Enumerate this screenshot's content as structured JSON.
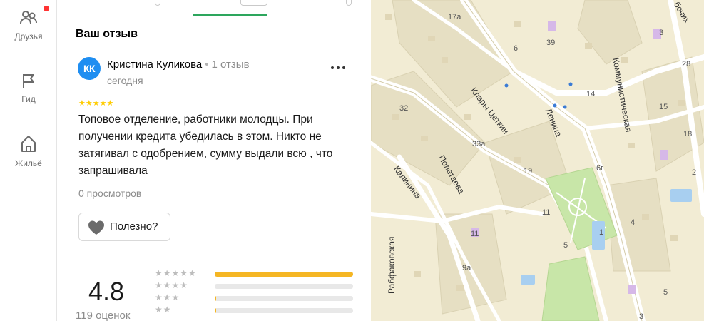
{
  "sidebar": {
    "items": [
      {
        "label": "Друзья",
        "icon": "friends-icon"
      },
      {
        "label": "Гид",
        "icon": "flag-icon"
      },
      {
        "label": "Жильё",
        "icon": "house-icon"
      }
    ]
  },
  "review_section": {
    "title": "Ваш отзыв",
    "author": {
      "initials": "КК",
      "name": "Кристина Куликова",
      "separator": "•",
      "reviews_count": "1 отзыв",
      "date": "сегодня"
    },
    "rating_stars": "★★★★★",
    "text": "Топовое отделение, работники молодцы. При получении кредита убедилась в этом. Никто не затягивал с одобрением, сумму выдали всю , что запрашивала",
    "views": "0 просмотров",
    "helpful_label": "Полезно?"
  },
  "rating_summary": {
    "value": "4.8",
    "count": "119 оценок",
    "bars": [
      {
        "stars": "★★★★★",
        "fraction": 1.0
      },
      {
        "stars": "★★★★",
        "fraction": 0.0
      },
      {
        "stars": "★★★",
        "fraction": 0.01
      },
      {
        "stars": "★★",
        "fraction": 0.01
      }
    ]
  },
  "map": {
    "streets": [
      "Клары Цеткин",
      "Ленина",
      "Коммунистическая",
      "Полетаева",
      "Калинина",
      "Рабфаковская",
      "бочих"
    ],
    "house_numbers": [
      "17а",
      "39",
      "3",
      "28",
      "14",
      "32",
      "15",
      "18",
      "33а",
      "19",
      "6г",
      "11",
      "1",
      "11",
      "9а",
      "4",
      "5",
      "3",
      "5",
      "6",
      "2"
    ]
  },
  "colors": {
    "accent_green": "#2da65d",
    "star_yellow": "#ffcc00",
    "bar_fill": "#f5b623",
    "avatar_blue": "#1f8ef1"
  }
}
